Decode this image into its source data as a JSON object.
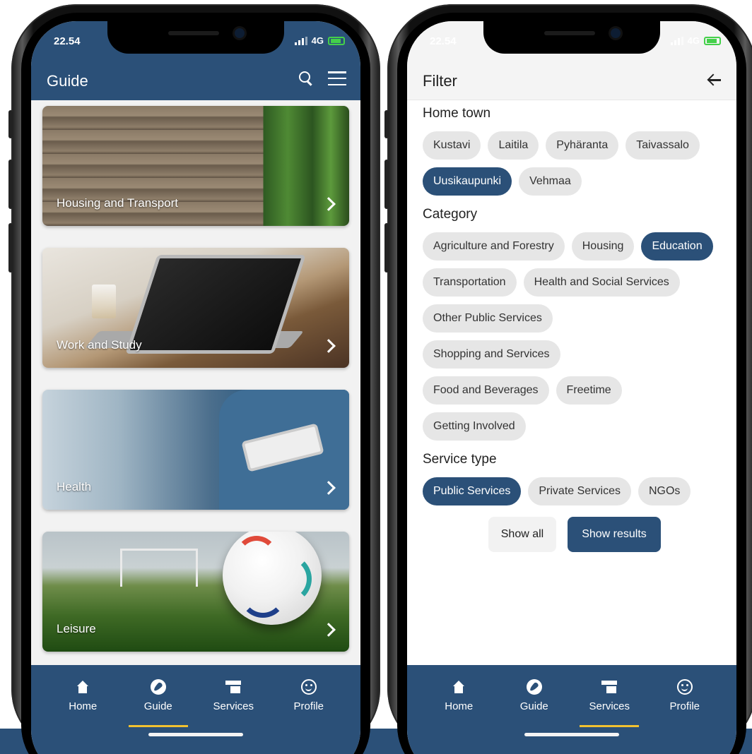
{
  "left": {
    "status": {
      "time": "22.54",
      "network": "4G"
    },
    "header": {
      "title": "Guide"
    },
    "cards": [
      {
        "label": "Housing and Transport",
        "image": "wood-wall-plant"
      },
      {
        "label": "Work and Study",
        "image": "laptop-desk"
      },
      {
        "label": "Health",
        "image": "nurse-tablet"
      },
      {
        "label": "Leisure",
        "image": "football-grass"
      }
    ],
    "tabs": [
      {
        "label": "Home",
        "icon": "home-icon"
      },
      {
        "label": "Guide",
        "icon": "compass-icon",
        "active": true
      },
      {
        "label": "Services",
        "icon": "store-icon"
      },
      {
        "label": "Profile",
        "icon": "smile-icon"
      }
    ]
  },
  "right": {
    "status": {
      "time": "22.54",
      "network": "4G"
    },
    "header": {
      "title": "Filter"
    },
    "sections": [
      {
        "title": "Home town",
        "chips": [
          {
            "label": "Kustavi"
          },
          {
            "label": "Laitila"
          },
          {
            "label": "Pyhäranta"
          },
          {
            "label": "Taivassalo"
          },
          {
            "label": "Uusikaupunki",
            "selected": true
          },
          {
            "label": "Vehmaa"
          }
        ]
      },
      {
        "title": "Category",
        "chips": [
          {
            "label": "Agriculture and Forestry"
          },
          {
            "label": "Housing"
          },
          {
            "label": "Education",
            "selected": true
          },
          {
            "label": "Transportation"
          },
          {
            "label": "Health and Social Services"
          },
          {
            "label": "Other Public Services"
          },
          {
            "label": "Shopping and Services"
          },
          {
            "label": "Food and Beverages"
          },
          {
            "label": "Freetime"
          },
          {
            "label": "Getting Involved"
          }
        ]
      },
      {
        "title": "Service type",
        "chips": [
          {
            "label": "Public Services",
            "selected": true
          },
          {
            "label": "Private Services"
          },
          {
            "label": "NGOs"
          }
        ]
      }
    ],
    "actions": {
      "show_all": "Show all",
      "show_results": "Show results"
    },
    "tabs": [
      {
        "label": "Home",
        "icon": "home-icon"
      },
      {
        "label": "Guide",
        "icon": "compass-icon"
      },
      {
        "label": "Services",
        "icon": "store-icon",
        "active": true
      },
      {
        "label": "Profile",
        "icon": "smile-icon"
      }
    ]
  },
  "colors": {
    "brand": "#2b5078",
    "accent": "#f2c230",
    "chip": "#e6e6e6"
  }
}
